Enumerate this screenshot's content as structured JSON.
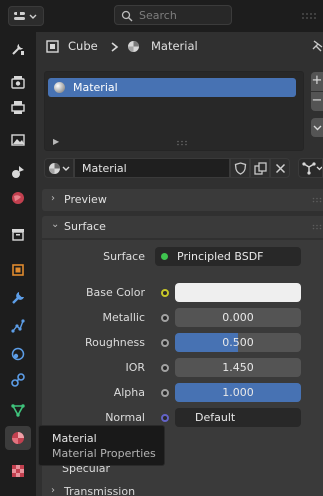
{
  "search": {
    "placeholder": "Search"
  },
  "breadcrumb": {
    "object": "Cube",
    "data": "Material"
  },
  "material_slots": [
    {
      "name": "Material"
    }
  ],
  "material_selector": {
    "name": "Material"
  },
  "sections": {
    "preview": "Preview",
    "surface": "Surface",
    "specular": "Specular",
    "transmission": "Transmission"
  },
  "surface": {
    "surface_label": "Surface",
    "surface_shader": "Principled BSDF",
    "properties": [
      {
        "label": "Base Color",
        "value": "",
        "fill": 1.0,
        "socket_color": "#c7c729"
      },
      {
        "label": "Metallic",
        "value": "0.000",
        "fill": 0.0,
        "socket_color": "#a1a1a1"
      },
      {
        "label": "Roughness",
        "value": "0.500",
        "fill": 0.5,
        "socket_color": "#a1a1a1"
      },
      {
        "label": "IOR",
        "value": "1.450",
        "fill": 0.0,
        "socket_color": "#a1a1a1"
      },
      {
        "label": "Alpha",
        "value": "1.000",
        "fill": 1.0,
        "socket_color": "#a1a1a1"
      },
      {
        "label": "Normal",
        "value": "Default",
        "socket_color": "#6363c7"
      }
    ]
  },
  "tooltip": {
    "title": "Material",
    "description": "Material Properties"
  },
  "colors": {
    "accent": "#4772b3",
    "panel": "#303030",
    "section": "#3a3a3a"
  },
  "tabs": [
    "tool-icon",
    "render-icon",
    "output-icon",
    "view-layer-icon",
    "scene-icon",
    "world-icon",
    "collection-icon",
    "object-icon",
    "modifier-icon",
    "particles-icon",
    "physics-icon",
    "constraint-icon",
    "data-icon",
    "material-icon",
    "texture-icon"
  ]
}
